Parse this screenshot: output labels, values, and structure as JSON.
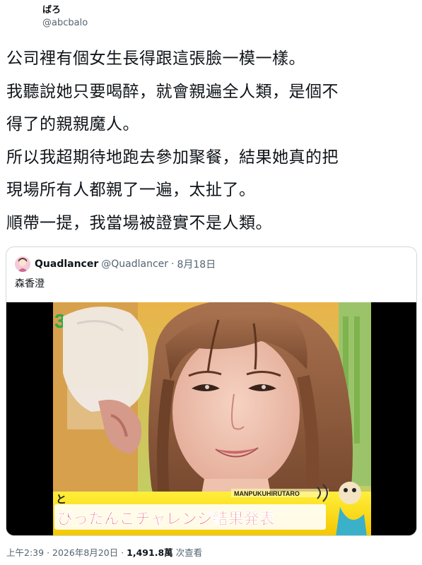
{
  "author": {
    "name": "ばろ",
    "handle": "@abcbalo"
  },
  "tweet": {
    "lines": [
      "公司裡有個女生長得跟這張臉一模一樣。",
      "我聽說她只要喝醉，就會親遍全人類，是個不",
      "得了的親親魔人。",
      "所以我超期待地跑去參加聚餐，結果她真的把",
      "現場所有人都親了一遍，太扯了。",
      "順帶一提，我當場被證實不是人類。"
    ]
  },
  "quote": {
    "name": "Quadlancer",
    "handle": "@Quadlancer",
    "separator": "·",
    "date": "8月18日",
    "text": "森香澄",
    "media": {
      "logo_text": "MANPUKUHIRUTARO",
      "caption": "ぴったんこチャレンジ結果発表"
    }
  },
  "meta": {
    "time": "上午2:39",
    "separator": "·",
    "date": "2026年8月20日",
    "views": "1,491.8萬",
    "views_label": "次查看"
  },
  "icons": [
    "avatar",
    "media-photo"
  ]
}
